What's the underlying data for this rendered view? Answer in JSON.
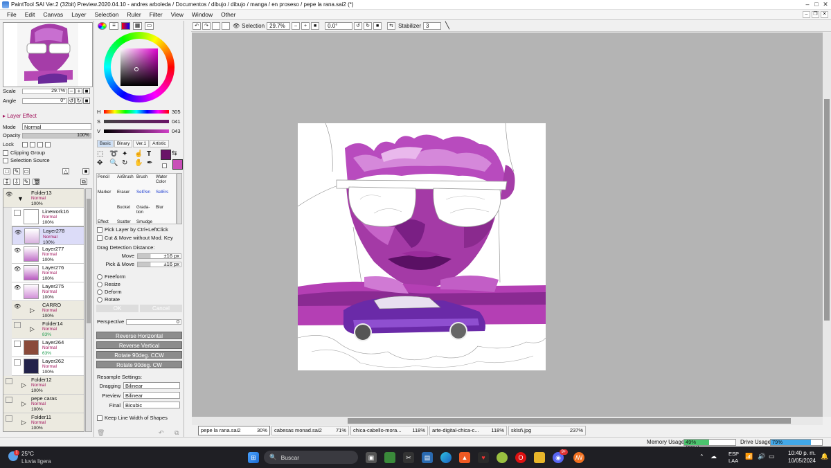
{
  "window": {
    "title": "PaintTool SAI Ver.2 (32bit) Preview.2020.04.10 - andres arboleda / Documentos / dibujo / dibujo / manga / en proseso / pepe la rana.sai2 (*)"
  },
  "menu": [
    "File",
    "Edit",
    "Canvas",
    "Layer",
    "Selection",
    "Ruler",
    "Filter",
    "View",
    "Window",
    "Other"
  ],
  "navigator": {
    "scale_label": "Scale",
    "scale_value": "29.7%",
    "angle_label": "Angle",
    "angle_value": "0°"
  },
  "layer_effect": {
    "header": "Layer Effect",
    "mode_label": "Mode",
    "mode_value": "Normal",
    "opacity_label": "Opacity",
    "opacity_value": "100%",
    "lock_label": "Lock",
    "clipping_group": "Clipping Group",
    "selection_source": "Selection Source"
  },
  "layers": [
    {
      "name": "Folder13",
      "mode": "Normal",
      "opacity": "100%",
      "folder": true,
      "visible": true
    },
    {
      "name": "Linework16",
      "mode": "Normal",
      "opacity": "100%",
      "folder": false,
      "visible": false
    },
    {
      "name": "Layer278",
      "mode": "Normal",
      "opacity": "100%",
      "folder": false,
      "visible": true,
      "selected": true
    },
    {
      "name": "Layer277",
      "mode": "Normal",
      "opacity": "100%",
      "folder": false,
      "visible": true
    },
    {
      "name": "Layer276",
      "mode": "Normal",
      "opacity": "100%",
      "folder": false,
      "visible": true
    },
    {
      "name": "Layer275",
      "mode": "Normal",
      "opacity": "100%",
      "folder": false,
      "visible": true
    },
    {
      "name": "CARRO",
      "mode": "Normal",
      "opacity": "100%",
      "folder": true,
      "visible": true
    },
    {
      "name": "Folder14",
      "mode": "Normal",
      "opacity": "83%",
      "folder": true,
      "visible": false
    },
    {
      "name": "Layer264",
      "mode": "Normal",
      "opacity": "63%",
      "folder": false,
      "visible": false
    },
    {
      "name": "Layer262",
      "mode": "Normal",
      "opacity": "100%",
      "folder": false,
      "visible": false
    },
    {
      "name": "Folder12",
      "mode": "Normal",
      "opacity": "100%",
      "folder": true,
      "visible": false
    },
    {
      "name": "pepe caras",
      "mode": "Normal",
      "opacity": "100%",
      "folder": true,
      "visible": false
    },
    {
      "name": "Folder11",
      "mode": "Normal",
      "opacity": "100%",
      "folder": true,
      "visible": false
    }
  ],
  "color": {
    "h_label": "H",
    "h": "305",
    "s_label": "S",
    "s": "041",
    "v_label": "V",
    "v": "043",
    "primary": "#6a1468",
    "secondary": "#c94fb8"
  },
  "tool_tabs": [
    "Basic",
    "Binary",
    "Ver.1",
    "Artistic"
  ],
  "brush_tools": [
    [
      "Pencil",
      "AirBrush",
      "Brush",
      "Water Color"
    ],
    [
      "Marker",
      "Eraser",
      "SelPen",
      "SelErs"
    ],
    [
      "",
      "Bucket",
      "Grada-tion",
      "Blur"
    ],
    [
      "Effect",
      "Scatter",
      "Smudge",
      ""
    ]
  ],
  "selection_opts": {
    "pick_layer": "Pick Layer by Ctrl+LeftClick",
    "cut_move": "Cut & Move without Mod. Key",
    "drag_label": "Drag Detection Distance:",
    "move_label": "Move",
    "move_value": "±16 px",
    "pickmove_label": "Pick & Move",
    "pickmove_value": "±16 px"
  },
  "transform": {
    "freeform": "Freeform",
    "resize": "Resize",
    "deform": "Deform",
    "rotate": "Rotate",
    "ok": "OK",
    "cancel": "Cancel",
    "perspective_label": "Perspective",
    "perspective_value": "0",
    "rev_h": "Reverse Horizontal",
    "rev_v": "Reverse Vertical",
    "rot_ccw": "Rotate 90deg. CCW",
    "rot_cw": "Rotate 90deg. CW"
  },
  "resample": {
    "header": "Resample Settings:",
    "dragging_label": "Dragging",
    "dragging_value": "Bilinear",
    "preview_label": "Preview",
    "preview_value": "Bilinear",
    "final_label": "Final",
    "final_value": "Bicubic",
    "keep_line": "Keep Line Width of Shapes"
  },
  "toolbar": {
    "selection": "Selection",
    "zoom": "29.7%",
    "angle": "0.0°",
    "stabilizer_label": "Stabilizer",
    "stabilizer_value": "3"
  },
  "doc_tabs": [
    {
      "name": "pepe la rana.sai2",
      "pct": "30%"
    },
    {
      "name": "cabesas monad.sai2",
      "pct": "71%"
    },
    {
      "name": "chica-cabello-mora...",
      "pct": "118%"
    },
    {
      "name": "arte-digital-chica-c...",
      "pct": "118%"
    },
    {
      "name": "sklsñ.jpg",
      "pct": "237%"
    }
  ],
  "status": {
    "memory_label": "Memory Usage",
    "memory_value": "49% (53%)",
    "memory_fill": 0.49,
    "drive_label": "Drive Usage",
    "drive_value": "79%",
    "drive_fill": 0.79
  },
  "taskbar": {
    "temp": "25°C",
    "weather": "Lluvia ligera",
    "search": "Buscar",
    "lang1": "ESP",
    "lang2": "LAA",
    "time": "10:40 p. m.",
    "date": "10/05/2024",
    "badge": "1",
    "discord_badge": "9+"
  }
}
